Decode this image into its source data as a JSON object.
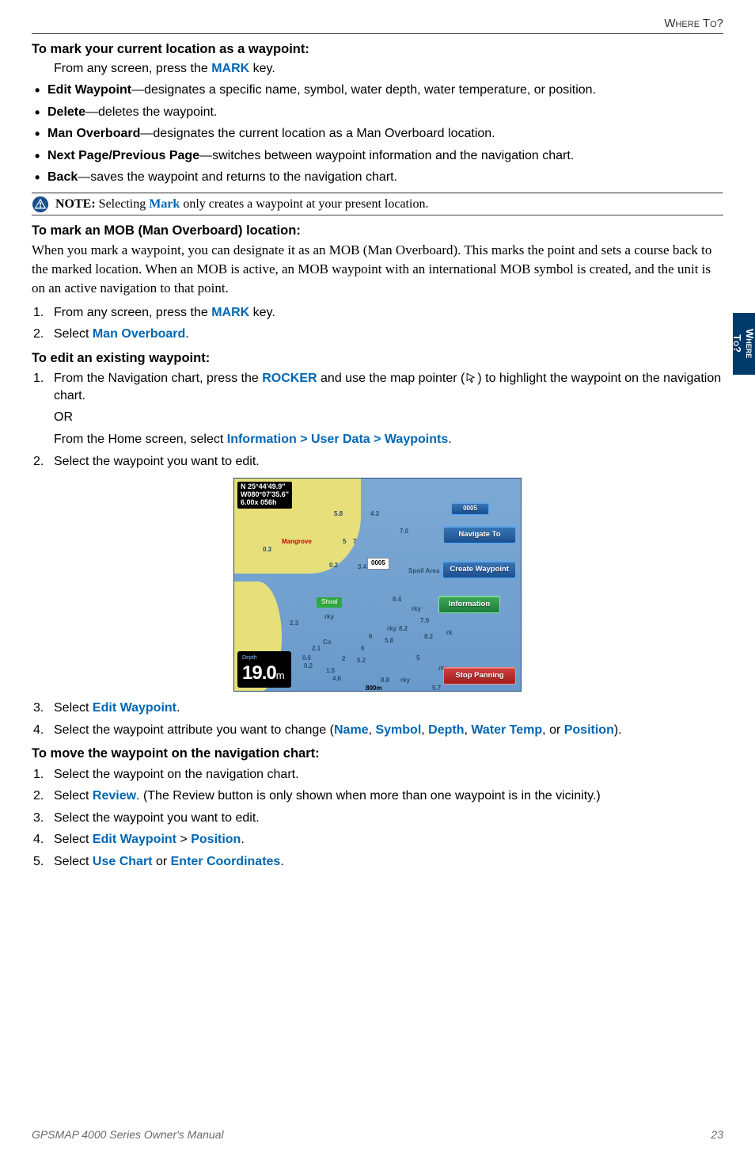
{
  "header": {
    "section": "Where To?"
  },
  "side_tab": {
    "line1": "Where",
    "line2": "To?"
  },
  "h1": "To mark your current location as a waypoint:",
  "p1_pre": "From any screen, press the ",
  "p1_key": "MARK",
  "p1_post": " key.",
  "bullets1": [
    {
      "lead": "Edit Waypoint",
      "rest": "—designates a specific name, symbol, water depth, water temperature, or position."
    },
    {
      "lead": "Delete",
      "rest": "—deletes the waypoint."
    },
    {
      "lead": "Man Overboard",
      "rest": "—designates the current location as a Man Overboard location."
    },
    {
      "lead": "Next Page/Previous Page",
      "rest": "—switches between waypoint information and the navigation chart."
    },
    {
      "lead": "Back",
      "rest": "—saves the waypoint and returns to the navigation chart."
    }
  ],
  "note": {
    "label": "NOTE:",
    "pre": " Selecting ",
    "key": "Mark",
    "post": " only creates a waypoint at your present location."
  },
  "h2": "To mark an MOB (Man Overboard) location:",
  "serif1": "When you mark a waypoint, you can designate it as an MOB (Man Overboard). This marks the point and sets a course back to the marked location. When an MOB is active, an MOB waypoint with an international MOB symbol is created, and the unit is on an active navigation to that point.",
  "list2": {
    "i1_pre": "From any screen, press the ",
    "i1_key": "MARK",
    "i1_post": " key.",
    "i2_pre": "Select ",
    "i2_key": "Man Overboard",
    "i2_post": "."
  },
  "h3": "To edit an existing waypoint:",
  "list3": {
    "i1_pre": "From the Navigation chart, press the ",
    "i1_key": "ROCKER",
    "i1_mid": " and use the map pointer (",
    "i1_post": ") to highlight the waypoint on the navigation chart.",
    "or": "OR",
    "i1b_pre": "From the Home screen, select ",
    "i1b_key": "Information > User Data > Waypoints",
    "i1b_post": ".",
    "i2": "Select the waypoint you want to edit."
  },
  "screenshot": {
    "coord_n": "N  25°44'49.9\"",
    "coord_w": "W080°07'35.6\"",
    "coord_zoom": "6.00x   056h",
    "depth_label": "Depth",
    "depth_value": "19.0",
    "depth_unit": "m",
    "btn_id": "0005",
    "btn_nav": "Navigate To",
    "btn_create": "Create Waypoint",
    "btn_info": "Information",
    "btn_stop": "Stop Panning",
    "wp_label": "0005",
    "label_shoal": "Shoal",
    "label_mangrove": "Mangrove",
    "label_spoil": "Spoil Area",
    "scale": "800m",
    "rky": "rky",
    "co": "Co",
    "soundings": [
      "5.8",
      "4.3",
      "7.0",
      "0.3",
      "5",
      "7",
      "0.2",
      "3.4",
      "8.4",
      "7.9",
      "8.2",
      "8.2",
      "5.8",
      "6",
      "6",
      "2.1",
      "5",
      "5.2",
      "8.8",
      "5.7",
      "1.5",
      "rk",
      "rks",
      "0.6",
      "4.6",
      "0.2",
      "2",
      "2.3"
    ]
  },
  "list4": {
    "i3_pre": "Select ",
    "i3_key": "Edit Waypoint",
    "i3_post": ".",
    "i4_pre": "Select the waypoint attribute you want to change (",
    "i4_a": "Name",
    "i4_b": "Symbol",
    "i4_c": "Depth",
    "i4_d": "Water Temp",
    "i4_mid_or": ", or ",
    "i4_e": "Position",
    "i4_post": ")."
  },
  "h4": "To move the waypoint on the navigation chart:",
  "list5": {
    "i1": "Select the waypoint on the navigation chart.",
    "i2_pre": "Select ",
    "i2_key": "Review",
    "i2_post": ". (The Review button is only shown when more than one waypoint is in the vicinity.)",
    "i3": "Select the waypoint you want to edit.",
    "i4_pre": "Select ",
    "i4_a": "Edit Waypoint",
    "i4_gt": " > ",
    "i4_b": "Position",
    "i4_post": ".",
    "i5_pre": "Select ",
    "i5_a": "Use Chart",
    "i5_or": " or ",
    "i5_b": "Enter Coordinates",
    "i5_post": "."
  },
  "footer": {
    "left": "GPSMAP 4000 Series Owner's Manual",
    "right": "23"
  }
}
